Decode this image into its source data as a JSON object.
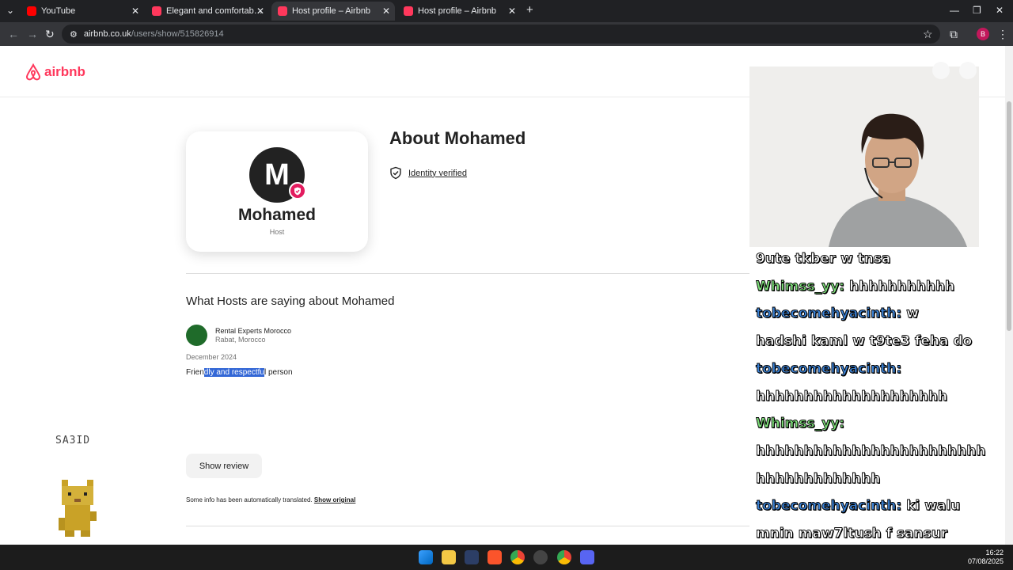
{
  "browser": {
    "tabs": [
      {
        "label": "YouTube",
        "color": "#ff0000"
      },
      {
        "label": "Elegant and comfortable apart",
        "color": "#ff385c"
      },
      {
        "label": "Host profile – Airbnb",
        "color": "#ff385c"
      },
      {
        "label": "Host profile – Airbnb",
        "color": "#ff385c"
      }
    ],
    "url_host": "airbnb.co.uk",
    "url_path": "/users/show/515826914"
  },
  "airbnb": {
    "logo_text": "airbnb",
    "brand_color": "#ff385c",
    "profile": {
      "initial": "M",
      "name": "Mohamed",
      "role": "Host"
    },
    "about_title": "About Mohamed",
    "identity_label": "Identity verified",
    "reviews_heading": "What Hosts are saying about Mohamed",
    "review": {
      "host_name": "Rental Experts Morocco",
      "host_location": "Rabat, Morocco",
      "date": "December 2024",
      "text_before": "Frien",
      "text_selected": "dly and respectfu",
      "text_after": "l person"
    },
    "show_review_label": "Show review",
    "translated_note": "Some info has been automatically translated.",
    "show_original_label": "Show original"
  },
  "overlay": {
    "streamer_tag": "SA3ID",
    "chat": [
      {
        "user": "",
        "text": "9ute tkber w tnsa"
      },
      {
        "user": "Whimss_yy:",
        "text": "hhhhhhhhhhh",
        "color": "u1"
      },
      {
        "user": "tobecomehyacinth:",
        "text": "w",
        "color": "u2"
      },
      {
        "user": "",
        "text": "hadshi kaml w t9te3 feha do"
      },
      {
        "user": "tobecomehyacinth:",
        "text": "",
        "color": "u2"
      },
      {
        "user": "",
        "text": "hhhhhhhhhhhhhhhhhhhh"
      },
      {
        "user": "Whimss_yy:",
        "text": "",
        "color": "u1"
      },
      {
        "user": "",
        "text": "hhhhhhhhhhhhhhhhhhhhhhhh"
      },
      {
        "user": "",
        "text": "hhhhhhhhhhhhh"
      },
      {
        "user": "tobecomehyacinth:",
        "text": "ki walu",
        "color": "u2"
      },
      {
        "user": "",
        "text": "mnin maw7ltush f sansur"
      }
    ]
  },
  "taskbar": {
    "time": "16:22",
    "date": "07/08/2025"
  }
}
